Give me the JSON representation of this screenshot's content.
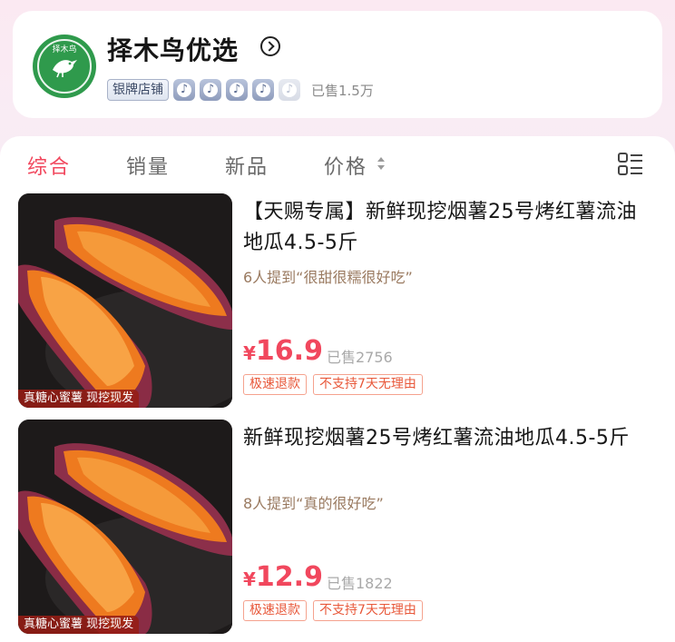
{
  "shop": {
    "logo_text": "择木鸟",
    "name": "择木鸟优选",
    "level_badge": "银牌店铺",
    "sold_total": "已售1.5万",
    "level_icons": [
      {
        "icon": "douyin-level-icon",
        "active": true
      },
      {
        "icon": "douyin-level-icon",
        "active": true
      },
      {
        "icon": "douyin-level-icon",
        "active": true
      },
      {
        "icon": "douyin-level-icon",
        "active": true
      },
      {
        "icon": "douyin-level-icon",
        "active": false
      }
    ]
  },
  "sort_tabs": [
    {
      "label": "综合",
      "active": true
    },
    {
      "label": "销量",
      "active": false
    },
    {
      "label": "新品",
      "active": false
    },
    {
      "label": "价格",
      "active": false
    }
  ],
  "products": [
    {
      "title": "【天赐专属】新鲜现挖烟薯25号烤红薯流油地瓜4.5-5斤",
      "review": "6人提到“很甜很糯很好吃”",
      "currency": "¥",
      "price": "16.9",
      "sold": "已售2756",
      "image_label": "真糖心蜜薯 现挖现发",
      "tags": [
        "极速退款",
        "不支持7天无理由"
      ]
    },
    {
      "title": "新鲜现挖烟薯25号烤红薯流油地瓜4.5-5斤",
      "review": "8人提到“真的很好吃”",
      "currency": "¥",
      "price": "12.9",
      "sold": "已售1822",
      "image_label": "真糖心蜜薯 现挖现发",
      "tags": [
        "极速退款",
        "不支持7天无理由"
      ]
    }
  ],
  "colors": {
    "accent": "#f1475d",
    "tag_border": "#f5a28e",
    "logo_green": "#2f9a4c"
  }
}
